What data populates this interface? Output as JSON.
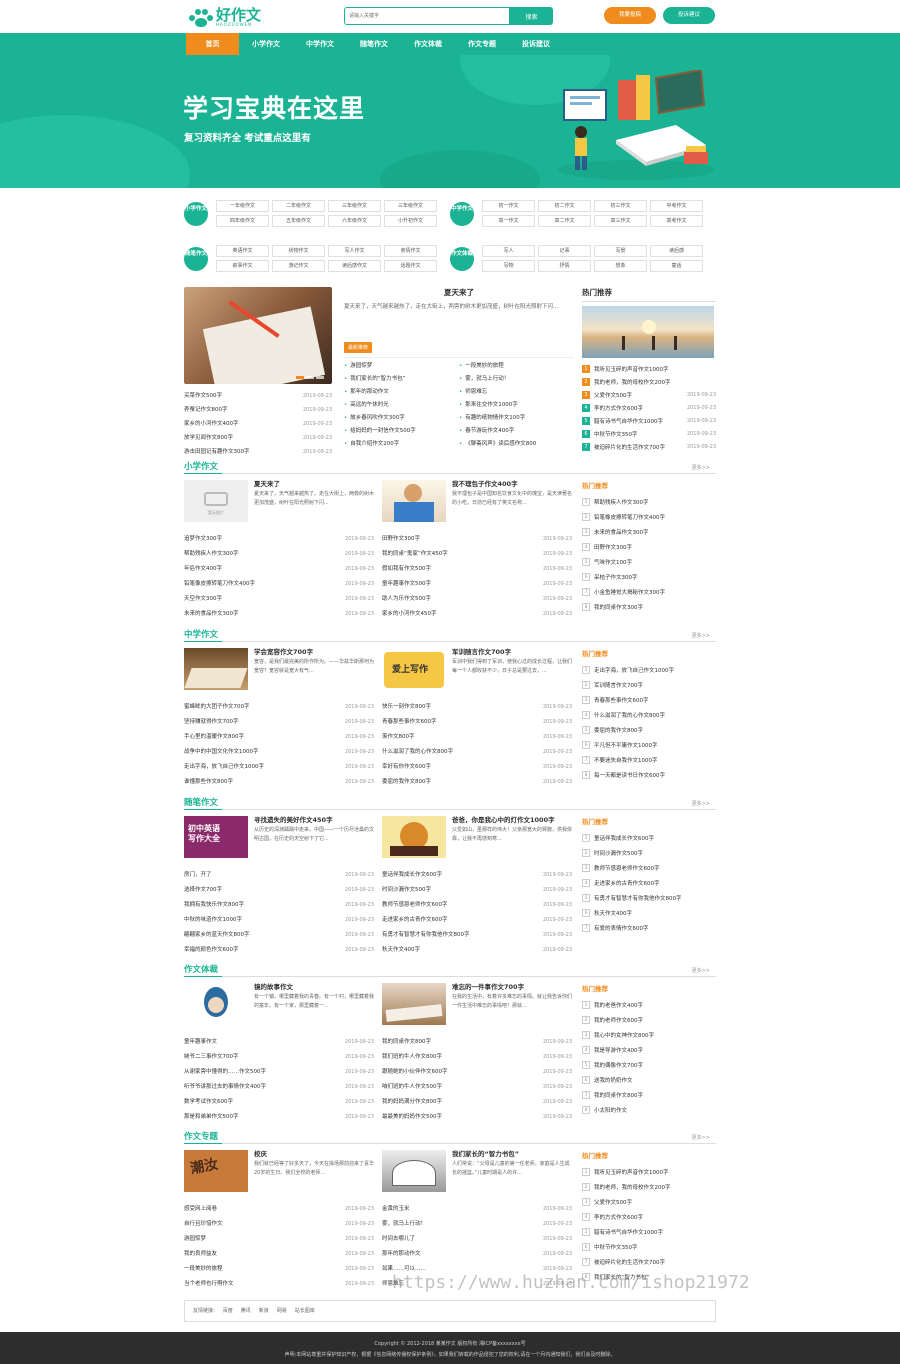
{
  "brand": {
    "name": "好作文",
    "sub": "HAOZUOWEN"
  },
  "header": {
    "search_placeholder": "请输入关键字",
    "search_button": "搜索",
    "submit": "我要投稿",
    "suggest": "投诉建议"
  },
  "nav": [
    "首页",
    "小学作文",
    "中学作文",
    "随笔作文",
    "作文体裁",
    "作文专题",
    "投诉建议"
  ],
  "banner": {
    "title": "学习宝典在这里",
    "subtitle": "复习资料齐全  考试重点这里有"
  },
  "categories": [
    {
      "badge": "小学作文",
      "items": [
        "一年级作文",
        "二年级作文",
        "三年级作文",
        "三年级作文",
        "四年级作文",
        "五年级作文",
        "六年级作文",
        "小升初作文"
      ]
    },
    {
      "badge": "中学作文",
      "items": [
        "初一作文",
        "初二作文",
        "初三作文",
        "中考作文",
        "高一作文",
        "高二作文",
        "高三作文",
        "高考作文"
      ]
    },
    {
      "badge": "随笔作文",
      "items": [
        "英语作文",
        "状物作文",
        "写人作文",
        "亲情作文",
        "叙事作文",
        "游记作文",
        "读后感作文",
        "话题作文"
      ]
    },
    {
      "badge": "作文体裁",
      "items": [
        "写人",
        "记事",
        "写景",
        "读后感",
        "写物",
        "抒情",
        "想象",
        "童话"
      ]
    }
  ],
  "top": {
    "left_list": [
      [
        "买菜作文500字",
        "2019-09-23"
      ],
      [
        "养蚕记作文800字",
        "2019-09-23"
      ],
      [
        "家乡的小河作文400字",
        "2019-09-23"
      ],
      [
        "放学见闻作文800字",
        "2019-09-23"
      ],
      [
        "游击田园记有趣作文300字",
        "2019-09-23"
      ]
    ],
    "featured_title": "夏天来了",
    "featured_text": "夏天来了，天气越来越热了，走在大街上，两旁的树木更加茂盛，树叶在阳光照射下闪...",
    "new_tag": "最新推荐",
    "new_list": [
      "游园惊梦",
      "一段美妙的旅程",
      "我们家长的“智力书包”",
      "雾，就马上行动！",
      "那年的那动作文",
      "师恩难忘",
      "高远的午休时光",
      "那来往交作文1000字",
      "故乡春风吹作文300字",
      "有趣的纸物情作文100字",
      "给妈妈的一封信作文500字",
      "春节游玩作文400字",
      "自我介绍作文200字",
      "《聊斋风声》读后感作文800"
    ],
    "hot_title": "热门推荐",
    "hot_list": [
      [
        "我听见玉碎的声音作文1000字",
        ""
      ],
      [
        "我的老师，我的母校作文200字",
        ""
      ],
      [
        "父爱作文500字",
        "2019-09-23"
      ],
      [
        "李的方式作文600字",
        "2019-09-23"
      ],
      [
        "腊有诗书气自华作文1000字",
        "2019-09-23"
      ],
      [
        "中秋节作文350字",
        "2019-09-23"
      ],
      [
        "被迫碎片化的生活作文700字",
        "2019-09-23"
      ]
    ]
  },
  "sections": [
    {
      "title": "小学作文",
      "more": "更多>>",
      "a1": {
        "title": "夏天来了",
        "text": "夏天来了，天气越来越热了。走在大街上，两旁的树木更加茂盛，树叶在阳光照射下闪...",
        "placeholder": "暂无图片"
      },
      "a2": {
        "title": "我不理包子作文400字",
        "text": "我不理包子是中国知名饮食文化中的瑰宝，是天津著名的小吃，日前已经有了英文名称..."
      },
      "l1": [
        [
          "追梦作文300字",
          "2019-09-23"
        ],
        [
          "帮助残疾人作文300字",
          "2019-09-23"
        ],
        [
          "年俗作文400字",
          "2019-09-23"
        ],
        [
          "铅笔像皮擦转笔刀作文400字",
          "2019-09-23"
        ],
        [
          "天空作文300字",
          "2019-09-23"
        ],
        [
          "未来的食品作文300字",
          "2019-09-23"
        ]
      ],
      "l2": [
        [
          "田野作文300字",
          "2019-09-23"
        ],
        [
          "我的同桌“鬼家”作文450字",
          "2019-09-23"
        ],
        [
          "假如我有作文500字",
          "2019-09-23"
        ],
        [
          "童年趣事作文500字",
          "2019-09-23"
        ],
        [
          "助人为乐作文500字",
          "2019-09-23"
        ],
        [
          "家乡的小河作文450字",
          "2019-09-23"
        ]
      ],
      "side_title": "热门推荐",
      "side": [
        "帮助残疾人作文300字",
        "铅笔橡皮擦转笔刀作文400字",
        "未来的食品作文300字",
        "田野作文300字",
        "气味作文100字",
        "采桔子作文300字",
        "小金鱼睡觉大揭秘作文300字",
        "我的同桌作文300字"
      ]
    },
    {
      "title": "中学作文",
      "more": "更多>>",
      "a1": {
        "title": "学会宽容作文700字",
        "text": "宽容，是我们最完美的所作所为。——华兹华斯那何为宽容？宽容就是宽大有气..."
      },
      "a2": {
        "title": "军训随言作文700字",
        "text": "军训中我们得到了军训，使我心过的成长过程，让我们每一个人都收获不少。日子总是要过去，..."
      },
      "l1": [
        [
          "蜜蜂眸的大团子作文700字",
          "2019-09-23"
        ],
        [
          "坚持赚就得作文700字",
          "2019-09-23"
        ],
        [
          "手心里的温暖作文800字",
          "2019-09-23"
        ],
        [
          "战争中的中国文化作文1000字",
          "2019-09-23"
        ],
        [
          "走出字海，放飞自己作文1000字",
          "2019-09-23"
        ],
        [
          "谁懂那些作文800字",
          "2019-09-23"
        ]
      ],
      "l2": [
        [
          "快乐一刻作文800字",
          "2019-09-23"
        ],
        [
          "青春那些事作文600字",
          "2019-09-23"
        ],
        [
          "羡作文800字",
          "2019-09-23"
        ],
        [
          "什么滋润了我的心作文800字",
          "2019-09-23"
        ],
        [
          "幸好有你作文600字",
          "2019-09-23"
        ],
        [
          "委屈的我作文800字",
          "2019-09-23"
        ]
      ],
      "side_title": "热门推荐",
      "side": [
        "走出字海，放飞自己作文1000字",
        "军训随言作文700字",
        "青春那些事作文600字",
        "什么滋润了我的心作文800字",
        "委屈的我作文800字",
        "平凡但不平庸作文1000字",
        "不要迷失自我作文1000字",
        "每一天都是读书日作文600字"
      ]
    },
    {
      "title": "随笔作文",
      "more": "更多>>",
      "a1": {
        "title": "寻找遗失的美好作文450字",
        "text": "从历史的深渊踽踽中走来，中国——一个历尽沧桑的文明古国，在历史的天空射下了它..."
      },
      "a2": {
        "title": "爸爸，你是我心中的灯作文1000字",
        "text": "父爱如山，虽那样的伟大！父亲那宽大的臂膀，供我依靠，让我不再感到寒..."
      },
      "l1": [
        [
          "房门，开了",
          "2019-09-23"
        ],
        [
          "选择作文700字",
          "2019-09-23"
        ],
        [
          "我拥有我快乐作文800字",
          "2019-09-23"
        ],
        [
          "中秋的味道作文1000字",
          "2019-09-23"
        ],
        [
          "翩翩家乡的蓝天作文800字",
          "2019-09-23"
        ],
        [
          "幸福的颜色作文600字",
          "2019-09-23"
        ]
      ],
      "l2": [
        [
          "童话伴我成长作文600字",
          "2019-09-23"
        ],
        [
          "时间沙漏作文500字",
          "2019-09-23"
        ],
        [
          "教师节感恩老师作文600字",
          "2019-09-23"
        ],
        [
          "走进家乡的古青作文600字",
          "2019-09-23"
        ],
        [
          "有勇才有智慧才有你我他作文800字",
          "2019-09-23"
        ],
        [
          "秋天作文400字",
          "2019-09-23"
        ]
      ],
      "side_title": "热门推荐",
      "side": [
        "童话伴我成长作文600字",
        "时间沙漏作文500字",
        "教师节感恩老师作文600字",
        "走进家乡的古青作文600字",
        "有勇才有智慧才有你我他作文800字",
        "秋天作文400字",
        "有爱的表情作文600字"
      ]
    },
    {
      "title": "作文体裁",
      "more": "更多>>",
      "a1": {
        "title": "镜的故事作文",
        "text": "有一个镇，哪里藏着我的青春。有一个村，哪里藏着我的童年。有一个家，那里藏着一..."
      },
      "a2": {
        "title": "难忘的一件事作文700字",
        "text": "在我的生活中，有着许多难忘的事情。就让我告诉你们一件生活中难忘的事情吧！那就..."
      },
      "l1": [
        [
          "童年趣事作文",
          "2019-09-23"
        ],
        [
          "姥爷二三事作文700字",
          "2019-09-23"
        ],
        [
          "从谢家旁中懂得的……作文500字",
          "2019-09-23"
        ],
        [
          "听爷爷讲那过去的事情作文400字",
          "2019-09-23"
        ],
        [
          "数学考试作文600字",
          "2019-09-23"
        ],
        [
          "那是和弟弟作文500字",
          "2019-09-23"
        ]
      ],
      "l2": [
        [
          "我的同桌作文800字",
          "2019-09-23"
        ],
        [
          "我们班的牛人作文800字",
          "2019-09-23"
        ],
        [
          "跟随她的小伙伴作文600字",
          "2019-09-23"
        ],
        [
          "咱们班的牛人作文500字",
          "2019-09-23"
        ],
        [
          "我的妈妈满分作文800字",
          "2019-09-23"
        ],
        [
          "最最美的妈妈作文500字",
          "2019-09-23"
        ]
      ],
      "side_title": "热门推荐",
      "side": [
        "我的老爸作文400字",
        "我的老师作文600字",
        "我心中的女神作文800字",
        "我是导游作文400字",
        "我的偶像作文700字",
        "送我的奶奶作文",
        "我的同桌作文800字",
        "小太阳的作文"
      ]
    },
    {
      "title": "作文专题",
      "more": "更多>>",
      "a1": {
        "title": "校庆",
        "text": "我们就已经等了好多天了，今天在操场那前迎来了喜华20岁的生日。我们全校的老师..."
      },
      "a2": {
        "title": "我们家长的“智力书包”",
        "text": "人们常说：“父母是儿童的第一任老师，家庭是人生成长的摇篮。”儿童时期是人的许..."
      },
      "l1": [
        [
          "感受网上阅卷",
          "2019-09-23"
        ],
        [
          "自行且珍惜作文",
          "2019-09-23"
        ],
        [
          "游园惊梦",
          "2019-09-23"
        ],
        [
          "我的良师益友",
          "2019-09-23"
        ],
        [
          "一段美妙的旅程",
          "2019-09-23"
        ],
        [
          "当个老师也行啊作文",
          "2019-09-23"
        ]
      ],
      "l2": [
        [
          "金黄的玉米",
          "2019-09-23"
        ],
        [
          "雾，就马上行动！",
          "2019-09-23"
        ],
        [
          "时间去哪儿了",
          "2019-09-23"
        ],
        [
          "那年的那动作文",
          "2019-09-23"
        ],
        [
          "如果……可以……",
          "2019-09-23"
        ],
        [
          "师恩难忘",
          "2019-09-23"
        ]
      ],
      "side_title": "热门推荐",
      "side": [
        "我听见玉碎的声音作文1000字",
        "我的老师，我的母校作文200字",
        "父爱作文500字",
        "李的方式作文600字",
        "腊有诗书气自华作文1000字",
        "中秋节作文350字",
        "被迫碎片化的生活作文700字",
        "我们家长的“智力书包”"
      ]
    }
  ],
  "links": {
    "label": "友情链接:",
    "items": [
      "百度",
      "腾讯",
      "新浪",
      "网易",
      "站长图库"
    ]
  },
  "footer": {
    "line1": "Copyright © 2012-2018 某某作文 版权所有  湘ICP备xxxxxxxx号",
    "line2": "声明:本网站尊重并保护知识产权，根据《信息网络传播权保护条例》，如果我们转载的作品侵犯了您的权利,请在一个月内通知我们，我们会及时删除。"
  },
  "watermark": "https://www.huzhan.com/ishop21972",
  "colors": {
    "primary": "#1ab394",
    "accent": "#f08c1e"
  }
}
